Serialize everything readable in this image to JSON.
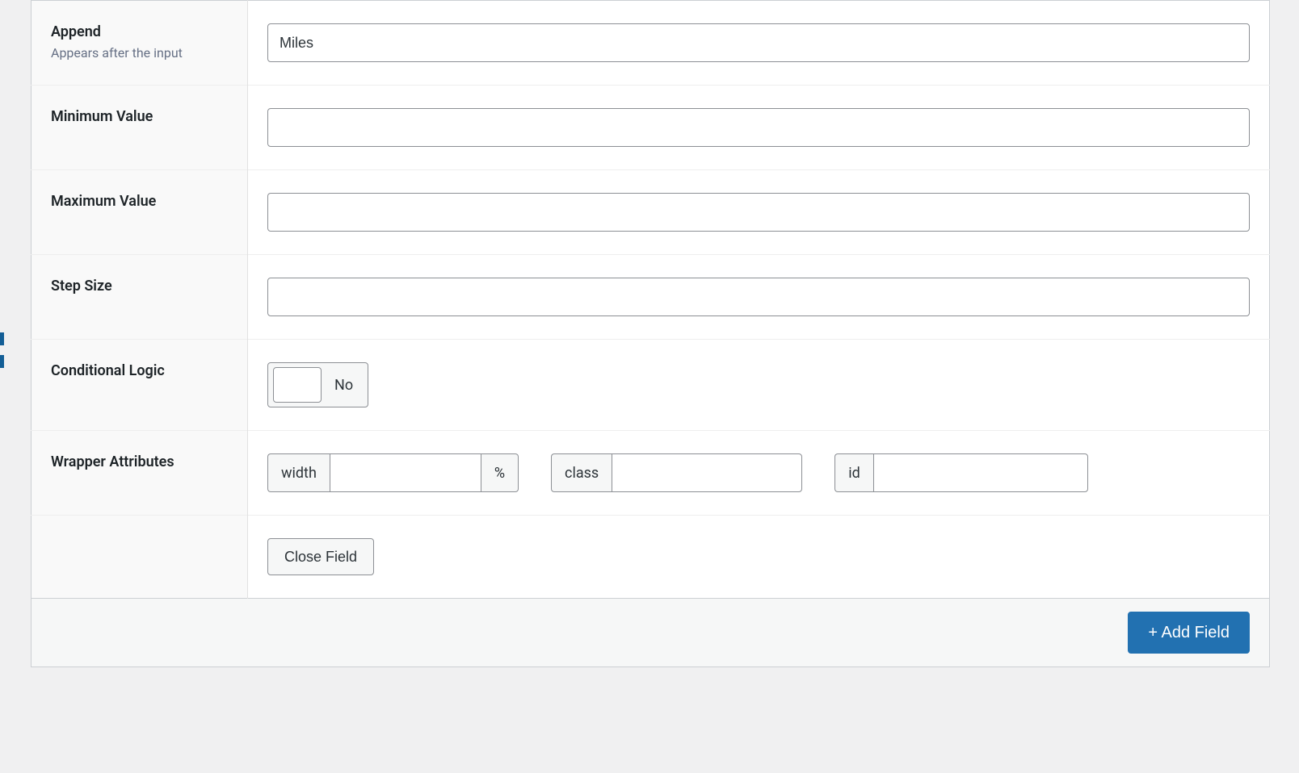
{
  "rows": {
    "append": {
      "label": "Append",
      "hint": "Appears after the input",
      "value": "Miles"
    },
    "min": {
      "label": "Minimum Value",
      "value": ""
    },
    "max": {
      "label": "Maximum Value",
      "value": ""
    },
    "step": {
      "label": "Step Size",
      "value": ""
    },
    "conditional": {
      "label": "Conditional Logic",
      "state_label": "No"
    },
    "wrapper": {
      "label": "Wrapper Attributes",
      "width_label": "width",
      "width_suffix": "%",
      "width_value": "",
      "class_label": "class",
      "class_value": "",
      "id_label": "id",
      "id_value": ""
    }
  },
  "actions": {
    "close_field": "Close Field",
    "add_field": "+ Add Field"
  }
}
